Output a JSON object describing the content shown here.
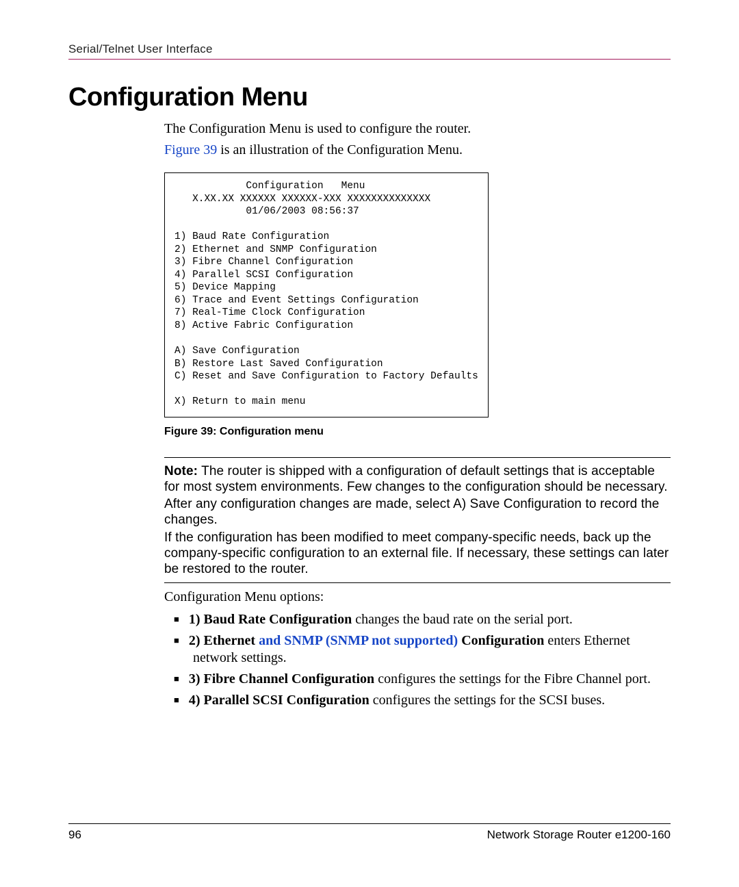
{
  "header": {
    "running_head": "Serial/Telnet User Interface"
  },
  "title": "Configuration Menu",
  "intro": {
    "line1": "The Configuration Menu is used to configure the router.",
    "figure_link": "Figure 39",
    "line2_rest": " is an illustration of the Configuration Menu."
  },
  "menu": {
    "title": "Configuration   Menu",
    "version_line": "X.XX.XX XXXXXX XXXXXX-XXX XXXXXXXXXXXXXX",
    "timestamp": "01/06/2003 08:56:37",
    "items_numbered": [
      "1) Baud Rate Configuration",
      "2) Ethernet and SNMP Configuration",
      "3) Fibre Channel Configuration",
      "4) Parallel SCSI Configuration",
      "5) Device Mapping",
      "6) Trace and Event Settings Configuration",
      "7) Real-Time Clock Configuration",
      "8) Active Fabric Configuration"
    ],
    "items_lettered": [
      "A) Save Configuration",
      "B) Restore Last Saved Configuration",
      "C) Reset and Save Configuration to Factory Defaults"
    ],
    "item_exit": "X) Return to main menu"
  },
  "figure_caption": "Figure 39:  Configuration menu",
  "note": {
    "label": "Note:",
    "p1": "The router is shipped with a configuration of default settings that is acceptable for most system environments. Few changes to the configuration should be necessary.",
    "p2": "After any configuration changes are made, select A) Save Configuration to record the changes.",
    "p3": "If the configuration has been modified to meet company-specific needs, back up the company-specific configuration to an external file. If necessary, these settings can later be restored to the router."
  },
  "options_intro": "Configuration Menu options:",
  "options": [
    {
      "bold_lead": "1) Baud Rate Configuration",
      "rest": " changes the baud rate on the serial port."
    },
    {
      "bold_lead": "2) Ethernet ",
      "blue": "and SNMP (SNMP not supported) ",
      "bold_tail": "Configuration",
      "rest": " enters Ethernet network settings."
    },
    {
      "bold_lead": "3) Fibre Channel Configuration",
      "rest": " configures the settings for the Fibre Channel port."
    },
    {
      "bold_lead": "4) Parallel SCSI Configuration",
      "rest": " configures the settings for the SCSI buses."
    }
  ],
  "footer": {
    "page_number": "96",
    "doc_title": "Network Storage Router e1200-160"
  }
}
